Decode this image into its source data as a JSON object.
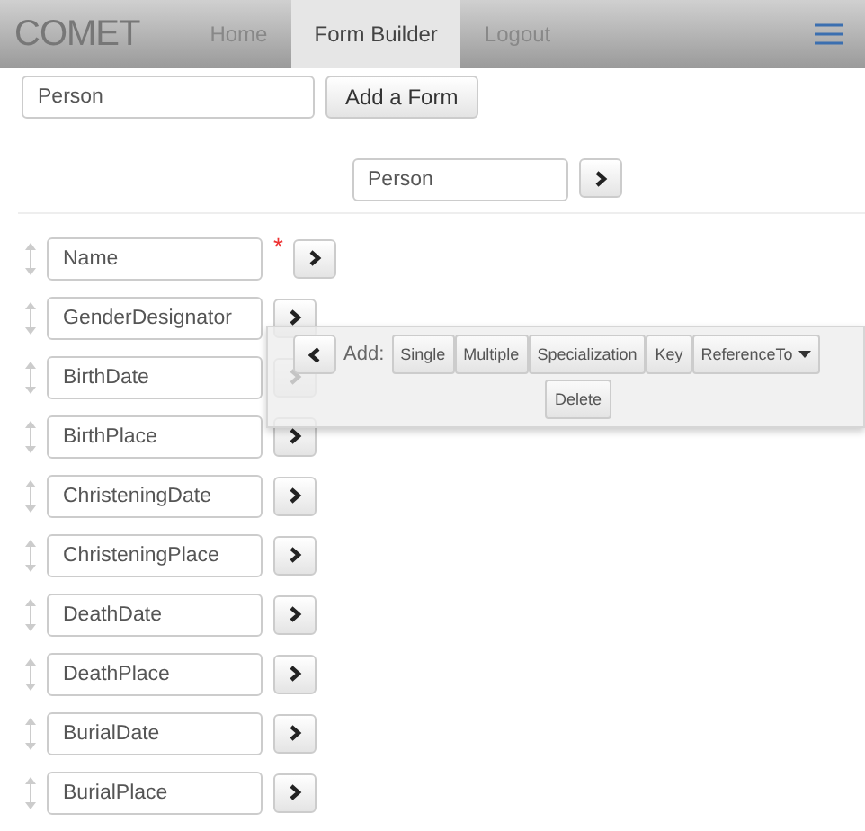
{
  "navbar": {
    "brand": "COMET",
    "tabs": [
      {
        "label": "Home",
        "selected": false
      },
      {
        "label": "Form Builder",
        "selected": true
      },
      {
        "label": "Logout",
        "selected": false
      }
    ]
  },
  "new_form": {
    "value": "Person",
    "button": "Add a Form"
  },
  "form": {
    "name": "Person"
  },
  "fields": [
    {
      "value": "Name",
      "marker": "*"
    },
    {
      "value": "GenderDesignator"
    },
    {
      "value": "BirthDate"
    },
    {
      "value": "BirthPlace"
    },
    {
      "value": "ChristeningDate"
    },
    {
      "value": "ChristeningPlace"
    },
    {
      "value": "DeathDate"
    },
    {
      "value": "DeathPlace"
    },
    {
      "value": "BurialDate"
    },
    {
      "value": "BurialPlace"
    }
  ],
  "popup": {
    "label": "Add:",
    "buttons": [
      {
        "label": "Single",
        "kind": "plain"
      },
      {
        "label": "Multiple",
        "kind": "plain"
      },
      {
        "label": "Specialization",
        "kind": "plain"
      },
      {
        "label": "Key",
        "kind": "plain"
      },
      {
        "label": "ReferenceTo",
        "kind": "dropdown"
      }
    ],
    "delete": "Delete"
  }
}
